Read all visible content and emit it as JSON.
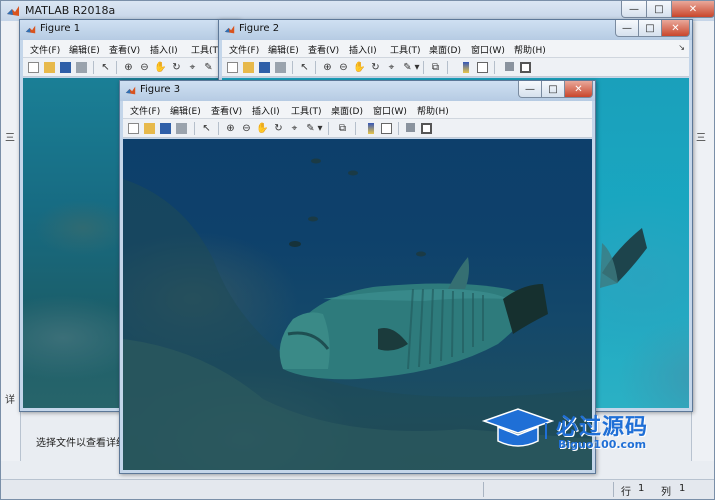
{
  "main": {
    "title": "MATLAB R2018a",
    "hint": "选择文件以查看详细信",
    "side_letters": [
      "三",
      "三",
      "详"
    ],
    "status": {
      "row_label": "行",
      "row_value": "1",
      "col_label": "列",
      "col_value": "1"
    }
  },
  "window_buttons": {
    "min": "—",
    "max": "□",
    "close": "✕"
  },
  "figures": {
    "f1": {
      "title": "Figure 1"
    },
    "f2": {
      "title": "Figure 2"
    },
    "f3": {
      "title": "Figure 3"
    }
  },
  "menu": {
    "file": "文件(F)",
    "edit": "编辑(E)",
    "view": "查看(V)",
    "insert": "插入(I)",
    "tools": "工具(T)",
    "desktop": "桌面(D)",
    "window": "窗口(W)",
    "help": "帮助(H)"
  },
  "dock_glyph": "↘",
  "toolbar_icons": [
    "new-file-icon",
    "open-folder-icon",
    "save-icon",
    "print-icon",
    "pointer-icon",
    "zoom-in-icon",
    "zoom-out-icon",
    "pan-hand-icon",
    "rotate-3d-icon",
    "data-cursor-icon",
    "brush-icon",
    "link-plot-icon",
    "colorbar-icon",
    "legend-icon",
    "hide-plot-tools-icon",
    "show-plot-tools-icon"
  ],
  "watermark": {
    "brand": "必过源码",
    "site": "Biguo100.com"
  },
  "colors": {
    "watermark": "#1f6fd6",
    "titlebar": "#c5d5e8",
    "close_button": "#c9462c"
  }
}
